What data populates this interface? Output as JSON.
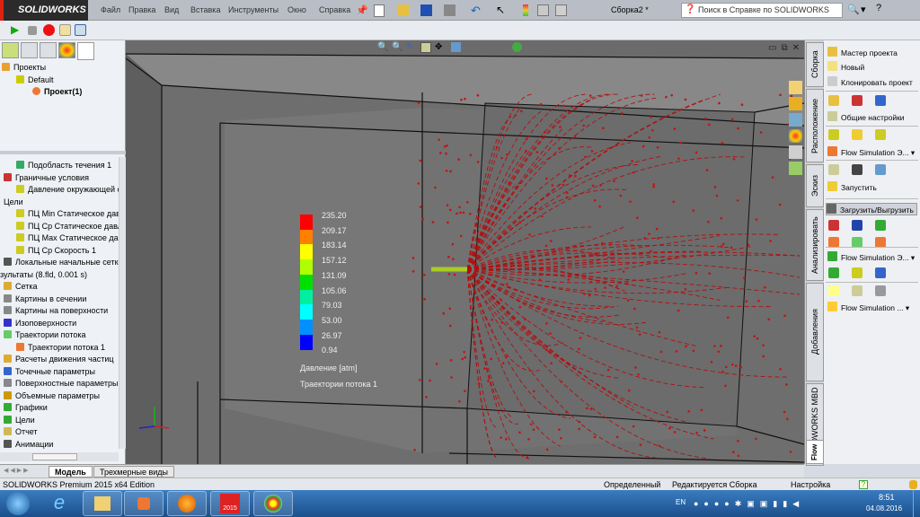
{
  "app": {
    "logo": "SOLIDWORKS",
    "document_title": "Сборка2 *",
    "search_placeholder": "Поиск в Справке по SOLIDWORKS"
  },
  "menu": [
    "Файл",
    "Правка",
    "Вид",
    "Вставка",
    "Инструменты",
    "Окно",
    "Справка"
  ],
  "left_panel": {
    "top_tree": [
      {
        "label": "Проекты"
      },
      {
        "label": "Default"
      },
      {
        "label": "Проект(1)"
      }
    ],
    "tree": [
      {
        "label": "Подобласть течения 1",
        "indent": 1,
        "color": "#3a6"
      },
      {
        "label": "Граничные условия",
        "indent": 0,
        "color": "#c33"
      },
      {
        "label": "Давление окружающей с",
        "indent": 1,
        "color": "#cc2"
      },
      {
        "label": "Цели",
        "indent": 0,
        "color": ""
      },
      {
        "label": "ПЦ Min Статическое давл",
        "indent": 1,
        "color": "#cc2"
      },
      {
        "label": "ПЦ Ср Статическое давле",
        "indent": 1,
        "color": "#cc2"
      },
      {
        "label": "ПЦ Max Статическое давл",
        "indent": 1,
        "color": "#cc2"
      },
      {
        "label": "ПЦ Ср Скорость 1",
        "indent": 1,
        "color": "#cc2"
      },
      {
        "label": "Локальные начальные сетки",
        "indent": 0,
        "color": "#555"
      },
      {
        "label": "зультаты (8.fld, 0.001 s)",
        "indent": -1,
        "color": ""
      },
      {
        "label": "Сетка",
        "indent": 0,
        "color": "#da3"
      },
      {
        "label": "Картины в сечении",
        "indent": 0,
        "color": "#888"
      },
      {
        "label": "Картины на поверхности",
        "indent": 0,
        "color": "#888"
      },
      {
        "label": "Изоповерхности",
        "indent": 0,
        "color": "#33c"
      },
      {
        "label": "Траектории потока",
        "indent": 0,
        "color": "#6c6"
      },
      {
        "label": "Траектории потока 1",
        "indent": 1,
        "color": "#e73"
      },
      {
        "label": "Расчеты движения частиц",
        "indent": 0,
        "color": "#da3"
      },
      {
        "label": "Точечные параметры",
        "indent": 0,
        "color": "#36c"
      },
      {
        "label": "Поверхностные параметры",
        "indent": 0,
        "color": "#888"
      },
      {
        "label": "Объемные параметры",
        "indent": 0,
        "color": "#c90"
      },
      {
        "label": "Графики",
        "indent": 0,
        "color": "#3a3"
      },
      {
        "label": "Цели",
        "indent": 0,
        "color": "#3a3"
      },
      {
        "label": "Отчет",
        "indent": 0,
        "color": "#cb5"
      },
      {
        "label": "Анимации",
        "indent": 0,
        "color": "#555"
      }
    ]
  },
  "legend": {
    "values": [
      "235.20",
      "209.17",
      "183.14",
      "157.12",
      "131.09",
      "105.06",
      "79.03",
      "53.00",
      "26.97",
      "0.94"
    ],
    "colors": [
      "#ff0000",
      "#ff7f00",
      "#ffff00",
      "#b0ff00",
      "#00e000",
      "#00f0a0",
      "#00ffff",
      "#0090ff",
      "#0000ff"
    ],
    "parameter": "Давление [atm]",
    "name": "Траектории потока 1"
  },
  "right_vtabs": [
    "Сборка",
    "Расположение",
    "Эскиз",
    "Анализировать",
    "Добавления SOLIDWORKS",
    "SOLIDWORKS MBD",
    "Flow Si..."
  ],
  "task_pane": {
    "items": [
      "Мастер проекта",
      "Новый",
      "Клонировать проект",
      "Общие настройки",
      "Flow Simulation Э...",
      "Запустить",
      "Загрузить/Выгрузить",
      "Flow Simulation Э...",
      "Flow Simulation ..."
    ]
  },
  "bottom_tabs": [
    "Модель",
    "Трехмерные виды"
  ],
  "status": {
    "edition": "SOLIDWORKS Premium 2015 x64 Edition",
    "state": "Определенный",
    "editing": "Редактируется Сборка",
    "settings": "Настройка"
  },
  "taskbar": {
    "lang": "EN",
    "time": "8:51",
    "date": "04.08.2016",
    "sw_badge": "2015"
  }
}
